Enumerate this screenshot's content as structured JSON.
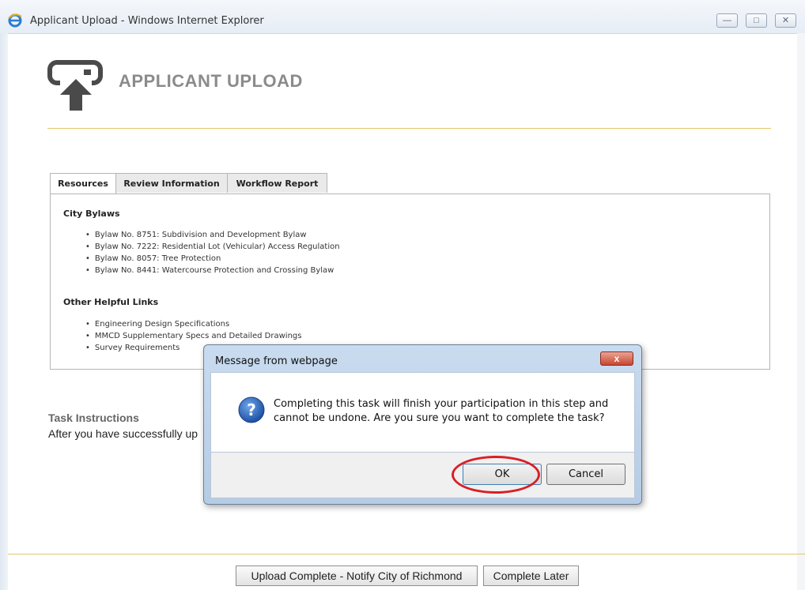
{
  "window": {
    "title": "Applicant Upload - Windows Internet Explorer",
    "minimize_icon": "minimize-icon",
    "restore_icon": "restore-icon",
    "close_icon": "close-icon",
    "browser_icon": "internet-explorer-icon"
  },
  "header": {
    "title": "APPLICANT UPLOAD",
    "icon": "upload-icon"
  },
  "tabs": [
    {
      "label": "Resources",
      "active": true
    },
    {
      "label": "Review Information",
      "active": false
    },
    {
      "label": "Workflow Report",
      "active": false
    }
  ],
  "resources": {
    "bylaws_heading": "City Bylaws",
    "bylaws": [
      "Bylaw No. 8751: Subdivision and Development Bylaw",
      "Bylaw No. 7222: Residential Lot (Vehicular) Access Regulation",
      "Bylaw No. 8057: Tree Protection",
      "Bylaw No. 8441: Watercourse Protection and Crossing Bylaw"
    ],
    "links_heading": "Other Helpful Links",
    "links": [
      "Engineering Design Specifications",
      "MMCD Supplementary Specs and Detailed Drawings",
      "Survey Requirements"
    ]
  },
  "task": {
    "heading": "Task Instructions",
    "text": "After you have successfully up"
  },
  "footer": {
    "upload_complete_label": "Upload Complete - Notify City of Richmond",
    "complete_later_label": "Complete Later"
  },
  "dialog": {
    "title": "Message from webpage",
    "message": "Completing this task will finish your participation in this step and cannot be undone. Are you sure you want to complete the task?",
    "ok_label": "OK",
    "cancel_label": "Cancel",
    "close_glyph": "x",
    "icon": "question-icon",
    "highlight_color": "#d91f26"
  },
  "colors": {
    "accent_rule": "#e4c66a",
    "title_gray": "#8b8b8b"
  }
}
